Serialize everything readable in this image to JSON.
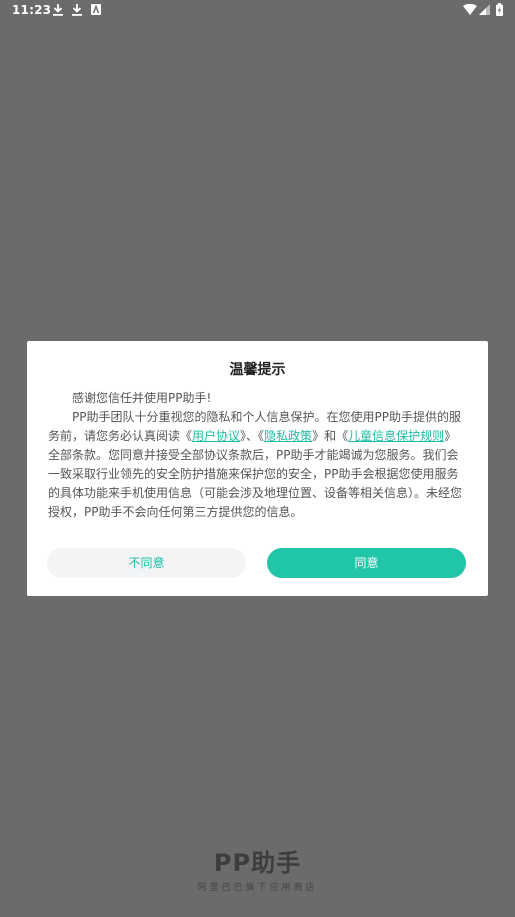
{
  "status_bar": {
    "time": "11:23",
    "icons": [
      "download-icon",
      "download-icon",
      "android-notification-icon",
      "wifi-icon",
      "cell-signal-icon",
      "battery-icon"
    ]
  },
  "dialog": {
    "title": "温馨提示",
    "greeting": "感谢您信任并使用PP助手!",
    "p2_text1": "PP助手团队十分重视您的隐私和个人信息保护。在您使用PP助手提供的服务前，请您务必认真阅读《",
    "link_user_agreement": "用户协议",
    "p2_text2": "》、《",
    "link_privacy_policy": "隐私政策",
    "p2_text3": "》和《",
    "link_children_rules": "儿童信息保护规则",
    "p2_text4": "》全部条款。您同意并接受全部协议条款后，PP助手才能竭诚为您服务。我们会一致采取行业领先的安全防护措施来保护您的安全，PP助手会根据您使用服务的具体功能来手机使用信息（可能会涉及地理位置、设备等相关信息）。未经您授权，PP助手不会向任何第三方提供您的信息。",
    "disagree_label": "不同意",
    "agree_label": "同意"
  },
  "brand": {
    "logo": "PP助手",
    "slogan": "阿里巴巴旗下应用商店"
  },
  "colors": {
    "overlay": "#6b6b6b",
    "accent": "#1dbda5",
    "agree_button": "#21c6a9"
  }
}
